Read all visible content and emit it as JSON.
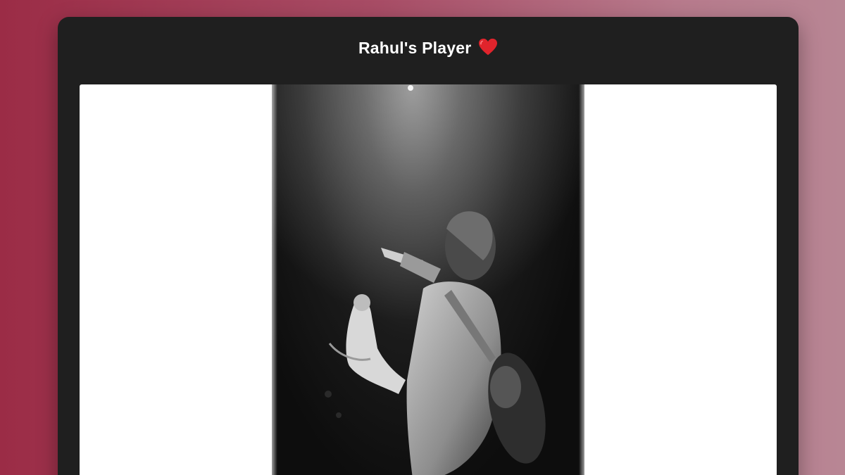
{
  "player": {
    "title": "Rahul's Player",
    "title_icon": "heart-icon",
    "accent_color": "#e0242c",
    "background_gradient": [
      "#9b2c46",
      "#b88694"
    ],
    "card_color": "#1f1f1f"
  },
  "cover": {
    "icon": "album-cover-image"
  }
}
